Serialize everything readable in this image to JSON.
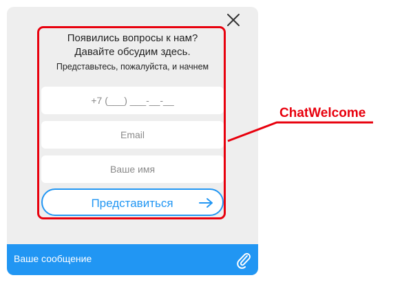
{
  "chat_widget": {
    "headline_line1": "Появились вопросы к нам?",
    "headline_line2": "Давайте обсудим здесь.",
    "subtitle": "Представьтесь, пожалуйста, и начнем",
    "phone_placeholder": "+7 (___) ___-__-__",
    "email_placeholder": "Email",
    "name_placeholder": "Ваше имя",
    "submit_label": "Представиться",
    "message_placeholder": "Ваше сообщение",
    "close_icon": "close-icon",
    "submit_icon": "arrow-right-icon",
    "attach_icon": "paperclip-icon"
  },
  "annotation": {
    "label": "ChatWelcome",
    "color": "#e8000d"
  },
  "colors": {
    "accent": "#2196f3",
    "panel_bg": "#eeeeee",
    "highlight": "#e8000d"
  }
}
